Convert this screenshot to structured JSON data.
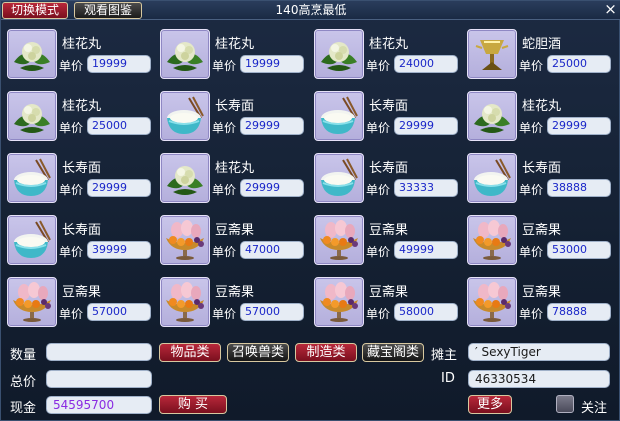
{
  "titlebar": {
    "switch_mode": "切换模式",
    "view_catalog": "观看图鉴",
    "title": "140高烹最低",
    "close": "×"
  },
  "price_label": "单价",
  "items": [
    {
      "name": "桂花丸",
      "price": "19999",
      "icon": "osmanthus-ball-icon"
    },
    {
      "name": "桂花丸",
      "price": "19999",
      "icon": "osmanthus-ball-icon"
    },
    {
      "name": "桂花丸",
      "price": "24000",
      "icon": "osmanthus-ball-icon"
    },
    {
      "name": "蛇胆酒",
      "price": "25000",
      "icon": "snake-wine-icon"
    },
    {
      "name": "桂花丸",
      "price": "25000",
      "icon": "osmanthus-ball-icon"
    },
    {
      "name": "长寿面",
      "price": "29999",
      "icon": "longevity-noodle-icon"
    },
    {
      "name": "长寿面",
      "price": "29999",
      "icon": "longevity-noodle-icon"
    },
    {
      "name": "桂花丸",
      "price": "29999",
      "icon": "osmanthus-ball-icon"
    },
    {
      "name": "长寿面",
      "price": "29999",
      "icon": "longevity-noodle-icon"
    },
    {
      "name": "桂花丸",
      "price": "29999",
      "icon": "osmanthus-ball-icon"
    },
    {
      "name": "长寿面",
      "price": "33333",
      "icon": "longevity-noodle-icon"
    },
    {
      "name": "长寿面",
      "price": "38888",
      "icon": "longevity-noodle-icon"
    },
    {
      "name": "长寿面",
      "price": "39999",
      "icon": "longevity-noodle-icon"
    },
    {
      "name": "豆斋果",
      "price": "47000",
      "icon": "bean-fruit-icon"
    },
    {
      "name": "豆斋果",
      "price": "49999",
      "icon": "bean-fruit-icon"
    },
    {
      "name": "豆斋果",
      "price": "53000",
      "icon": "bean-fruit-icon"
    },
    {
      "name": "豆斋果",
      "price": "57000",
      "icon": "bean-fruit-icon"
    },
    {
      "name": "豆斋果",
      "price": "57000",
      "icon": "bean-fruit-icon"
    },
    {
      "name": "豆斋果",
      "price": "58000",
      "icon": "bean-fruit-icon"
    },
    {
      "name": "豆斋果",
      "price": "78888",
      "icon": "bean-fruit-icon"
    }
  ],
  "footer": {
    "quantity_label": "数量",
    "quantity_value": "",
    "total_label": "总价",
    "total_value": "",
    "cash_label": "现金",
    "cash_value": "54595700",
    "cash_color": "#8a2be2",
    "tabs": [
      "物品类",
      "召唤兽类",
      "制造类",
      "藏宝阁类"
    ],
    "buy_label": "购 买",
    "owner_label": "摊主",
    "owner_value": "′ SexyTiger",
    "id_label": "ID",
    "id_value": "46330534",
    "more_label": "更多",
    "follow_label": "关注"
  },
  "colors": {
    "price_text": "#1a26c8",
    "red_button": "#9a1c2c",
    "icon_bg": "#c0bbe4"
  }
}
